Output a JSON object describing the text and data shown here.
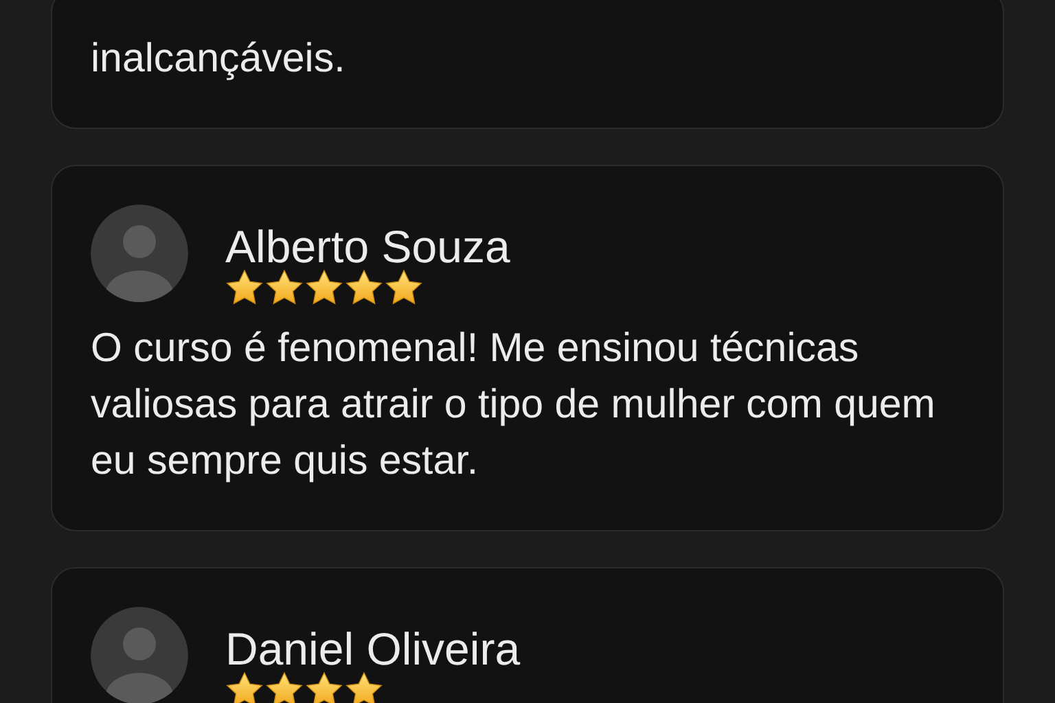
{
  "reviews": [
    {
      "kind": "partial",
      "text": "inalcançáveis."
    },
    {
      "kind": "full",
      "name": "Alberto Souza",
      "stars": 5,
      "text": "O curso é fenomenal! Me ensinou técnicas valiosas para atrair o tipo de mulher com quem eu sempre quis estar."
    },
    {
      "kind": "full",
      "name": "Daniel Oliveira",
      "stars": 4
    }
  ]
}
